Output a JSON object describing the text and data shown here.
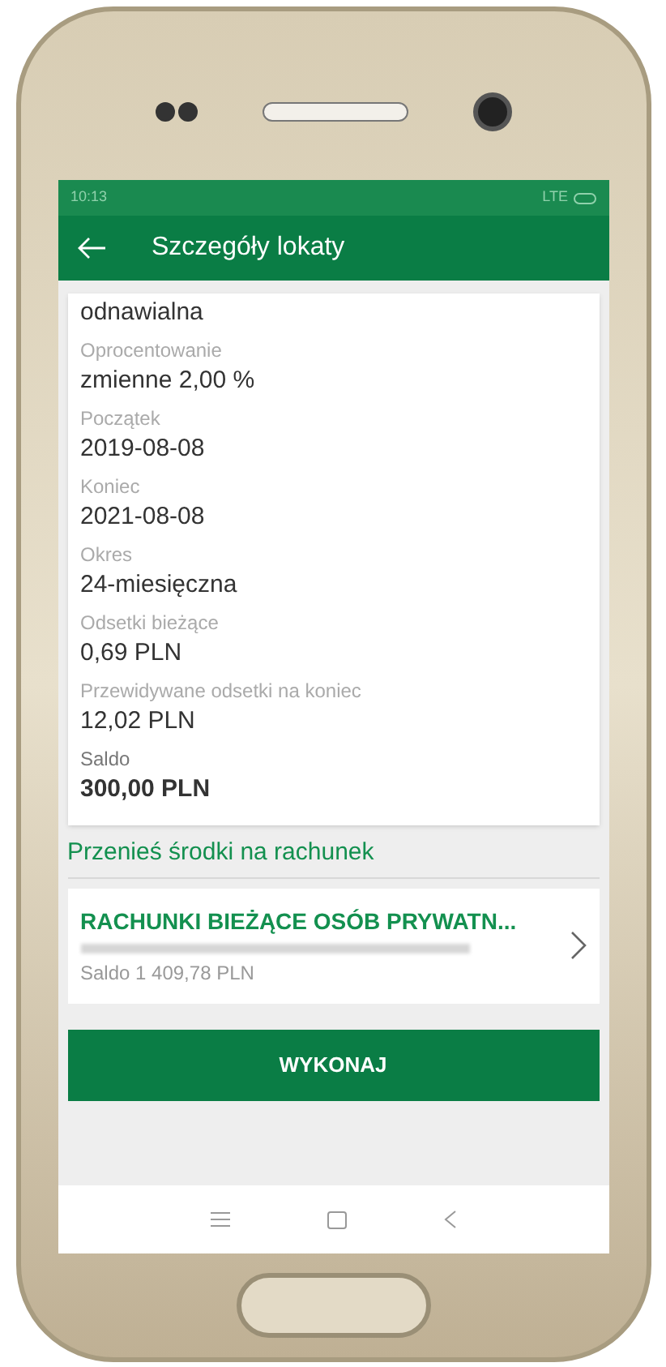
{
  "status_bar": {
    "time": "10:13",
    "network": "LTE"
  },
  "app_bar": {
    "title": "Szczegóły lokaty"
  },
  "details": [
    {
      "value": "odnawialna",
      "bold": false
    },
    {
      "label": "Oprocentowanie",
      "value": "zmienne 2,00 %",
      "bold": false
    },
    {
      "label": "Początek",
      "value": "2019-08-08",
      "bold": false
    },
    {
      "label": "Koniec",
      "value": "2021-08-08",
      "bold": false
    },
    {
      "label": "Okres",
      "value": "24-miesięczna",
      "bold": false
    },
    {
      "label": "Odsetki bieżące",
      "value": "0,69 PLN",
      "bold": false
    },
    {
      "label": "Przewidywane odsetki na koniec",
      "value": "12,02 PLN",
      "bold": false
    },
    {
      "label": "Saldo",
      "value": "300,00 PLN",
      "bold": true
    }
  ],
  "transfer": {
    "heading": "Przenieś środki na rachunek",
    "account_name": "RACHUNKI BIEŻĄCE OSÓB PRYWATN...",
    "balance": "Saldo 1 409,78 PLN"
  },
  "action_button": "WYKONAJ"
}
